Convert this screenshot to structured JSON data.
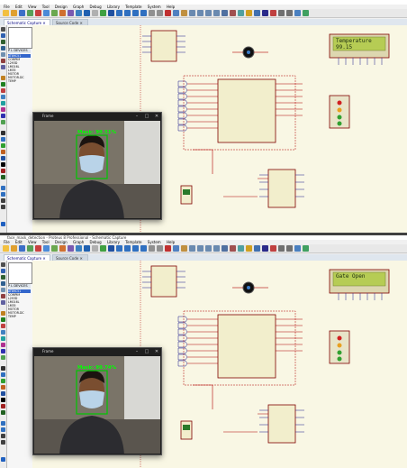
{
  "screens": [
    {
      "title": "",
      "menu": [
        "File",
        "Edit",
        "View",
        "Tool",
        "Design",
        "Graph",
        "Debug",
        "Library",
        "Template",
        "System",
        "Help"
      ],
      "tabs": [
        "Schematic Capture",
        "Source Code"
      ],
      "devices_label": "DEVICES",
      "devices": [
        "AT89C51",
        "COMPIM",
        "L293D",
        "LM016L",
        "LM35",
        "MOTOR",
        "MOTOR-DC",
        "TEMP"
      ],
      "selected_device": 0,
      "lcd_lines": [
        "Temperature",
        "99.15"
      ],
      "camera": {
        "title": "Frame",
        "label": "Mask: 99.51%",
        "box_color": "#00c800",
        "label_color": "#00ff00"
      }
    },
    {
      "title": "face_mask_detection - Proteus 8 Professional - Schematic Capture",
      "menu": [
        "File",
        "Edit",
        "View",
        "Tool",
        "Design",
        "Graph",
        "Debug",
        "Library",
        "Template",
        "System",
        "Help"
      ],
      "tabs": [
        "Schematic Capture",
        "Source Code"
      ],
      "devices_label": "DEVICES",
      "devices": [
        "AT89C51",
        "COMPIM",
        "L293D",
        "LM016L",
        "LM35",
        "MOTOR",
        "MOTOR-DC",
        "TEMP"
      ],
      "selected_device": 0,
      "lcd_lines": [
        "Gate Open",
        ""
      ],
      "camera": {
        "title": "Frame",
        "label": "Mask: 99.74%",
        "box_color": "#00c800",
        "label_color": "#00ff00"
      }
    }
  ],
  "colors": {
    "canvas": "#f9f7e4",
    "wire": "#b00000",
    "component_outline": "#800000",
    "pin": "#1a1a8c",
    "lcd_bg": "#b6cc54",
    "lcd_text": "#1c2c10",
    "selection": "#3366cc"
  }
}
